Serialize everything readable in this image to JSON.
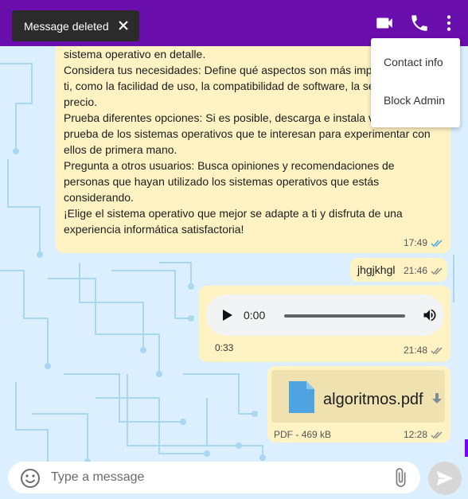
{
  "snackbar": {
    "text": "Message deleted"
  },
  "menu": {
    "items": [
      {
        "label": "Contact info"
      },
      {
        "label": "Block Admin"
      }
    ]
  },
  "messages": [
    {
      "text": "sistema operativo en detalle.\nConsidera tus necesidades: Define qué aspectos son más impo\nti, como la facilidad de uso, la compatibilidad de software, la se\nprecio.\nPrueba diferentes opciones: Si es posible, descarga e instala v\nprueba de los sistemas operativos que te interesan para experimentar con\nellos de primera mano.\nPregunta a otros usuarios: Busca opiniones y recomendaciones de\npersonas que hayan utilizado los sistemas operativos que estás\nconsiderando.\n¡Elige el sistema operativo que mejor se adapte a ti y disfruta de una\nexperiencia informática satisfactoria!",
      "time": "17:49"
    },
    {
      "text": "jhgjkhgl",
      "time": "21:46"
    },
    {
      "audio_current": "0:00",
      "duration": "0:33",
      "time": "21:48"
    },
    {
      "file_name": "algoritmos.pdf",
      "file_type": "PDF",
      "separator": "-",
      "file_size": "469 kB",
      "time": "12:28"
    }
  ],
  "composer": {
    "placeholder": "Type a message"
  },
  "colors": {
    "header": "#6a0dad",
    "bubble": "#fff3c4",
    "read_check": "#4fa3e0",
    "sent_check": "#8a8a8a"
  },
  "icons": [
    "video-call-icon",
    "phone-icon",
    "more-vert-icon",
    "close-icon",
    "play-icon",
    "volume-icon",
    "pdf-file-icon",
    "download-icon",
    "emoji-icon",
    "attach-icon",
    "send-icon"
  ]
}
